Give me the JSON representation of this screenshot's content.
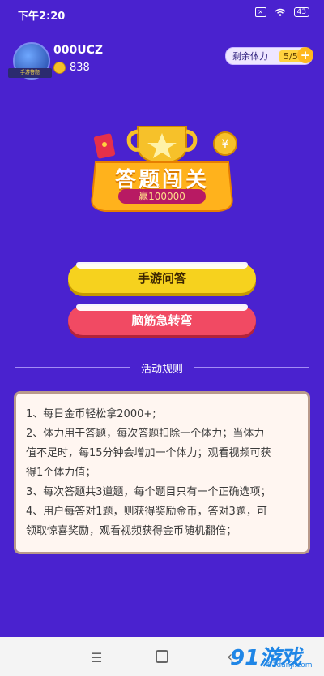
{
  "status_bar": {
    "time": "下午2:20",
    "battery": "43"
  },
  "user": {
    "name": "000UCZ",
    "coins": "838",
    "avatar_banner": "手游答题"
  },
  "stamina": {
    "label": "剩余体力",
    "value": "5/5",
    "plus": "+"
  },
  "logo": {
    "title": "答题闯关",
    "prize": "赢100000"
  },
  "buttons": {
    "quiz": "手游问答",
    "riddle": "脑筋急转弯"
  },
  "rules": {
    "title": "活动规则",
    "lines": [
      "1、每日金币轻松拿2000+;",
      "2、体力用于答题，每次答题扣除一个体力；当体力",
      "值不足时，每15分钟会增加一个体力；观看视频可获",
      "得1个体力值；",
      "3、每次答题共3道题，每个题目只有一个正确选项；",
      "4、用户每答对1题，则获得奖励金币，答对3题，可",
      "领取惊喜奖励，观看视频获得金币随机翻倍；"
    ]
  },
  "watermark": {
    "main": "91游戏",
    "sub": "91danji.com"
  },
  "colors": {
    "background": "#4a22cf",
    "quiz_button": "#f6d21e",
    "riddle_button": "#f14a63"
  }
}
